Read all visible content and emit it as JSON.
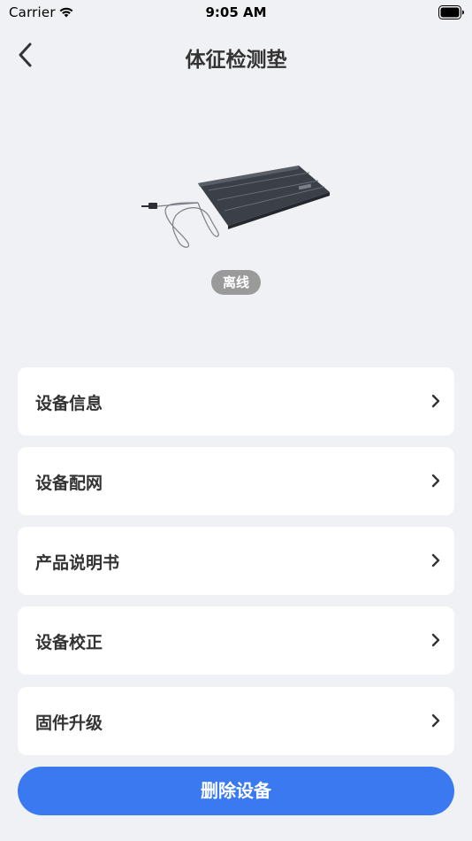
{
  "status_bar": {
    "carrier": "Carrier",
    "time": "9:05 AM",
    "icons": [
      "wifi-icon",
      "battery-icon"
    ]
  },
  "header": {
    "title": "体征检测垫",
    "back_icon": "chevron-left-icon"
  },
  "device": {
    "image": "sensor-mat-image",
    "status": "离线",
    "status_color": "#9a9a9a"
  },
  "menu": {
    "items": [
      {
        "label": "设备信息",
        "icon": "chevron-right-icon"
      },
      {
        "label": "设备配网",
        "icon": "chevron-right-icon"
      },
      {
        "label": "产品说明书",
        "icon": "chevron-right-icon"
      },
      {
        "label": "设备校正",
        "icon": "chevron-right-icon"
      },
      {
        "label": "固件升级",
        "icon": "chevron-right-icon"
      }
    ]
  },
  "actions": {
    "delete_label": "删除设备",
    "delete_color": "#3b79f1"
  },
  "colors": {
    "background": "#f0f1f5",
    "card": "#ffffff",
    "text": "#333333"
  }
}
